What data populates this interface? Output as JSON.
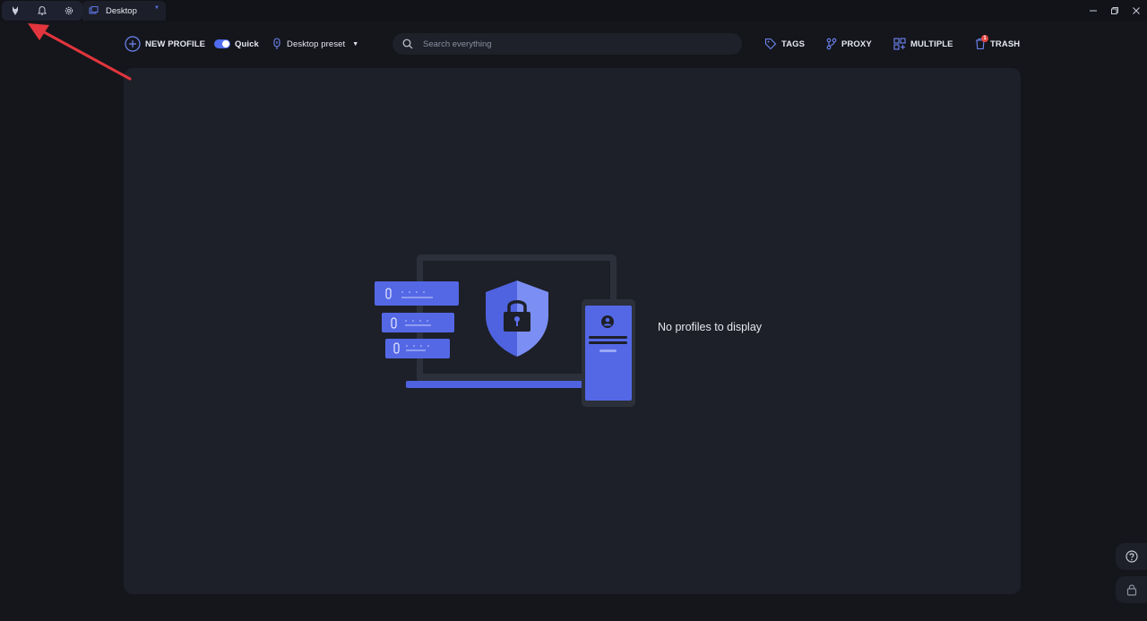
{
  "titlebar": {
    "tab": {
      "label": "Desktop"
    },
    "icons": [
      "app-logo-icon",
      "bell-icon",
      "gear-icon",
      "desktop-tab-icon",
      "minimize-icon",
      "restore-icon",
      "close-icon"
    ]
  },
  "toolbar": {
    "new_profile_label": "NEW PROFILE",
    "quick_label": "Quick",
    "quick_enabled": true,
    "preset_label": "Desktop preset",
    "search_placeholder": "Search everything",
    "tags_label": "TAGS",
    "proxy_label": "PROXY",
    "multiple_label": "MULTIPLE",
    "trash_label": "TRASH",
    "trash_count": "1"
  },
  "main": {
    "empty_message": "No profiles to display"
  },
  "side": {
    "icons": [
      "help-icon",
      "lock-icon"
    ]
  },
  "colors": {
    "accent": "#4f6cf0",
    "background": "#14161c",
    "panel": "#1d2028",
    "annotation_arrow": "#e2353d"
  }
}
